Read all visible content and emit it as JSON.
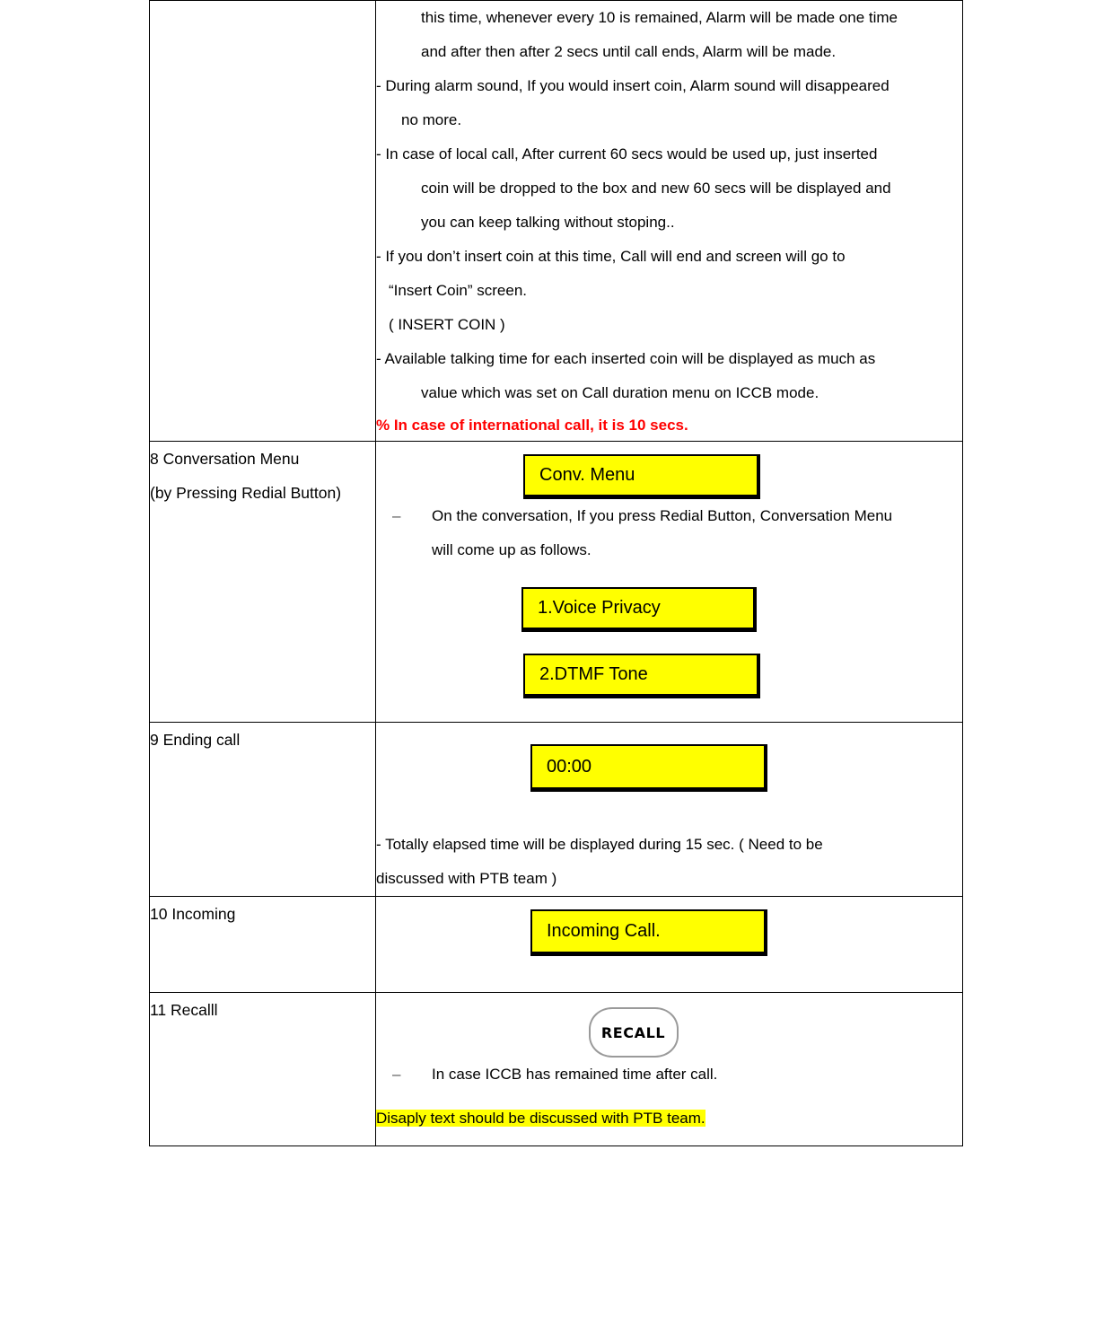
{
  "document": {
    "type": "specification-table",
    "table_columns": [
      "step",
      "description"
    ]
  },
  "rows": [
    {
      "id": "row-alarm-continuation",
      "label_lines": [],
      "paragraphs": [
        "this time, whenever every 10 is remained, Alarm will be made one time",
        "and after then after 2 secs until call ends, Alarm will be made.",
        "- During alarm sound, If you would insert coin, Alarm sound will disappeared",
        "no more.",
        "- In case of local call, After current 60 secs would be used up, just inserted",
        "coin will be dropped to the box and new 60 secs will be displayed and",
        "you can keep talking without stoping..",
        "- If you don’t insert coin at this time, Call will end and screen will go to",
        "“Insert Coin” screen.",
        "( INSERT COIN )",
        "- Available talking time for each inserted coin will be displayed as much as",
        "value which was set on Call duration menu on ICCB mode."
      ],
      "note_red": "% In case of international call, it is 10 secs."
    },
    {
      "id": "row-conversation-menu",
      "label_lines": [
        "8 Conversation Menu",
        "(by Pressing Redial Button)"
      ],
      "lcd_primary": "Conv. Menu",
      "bullet": {
        "mark": "–",
        "line1": "On the conversation, If you press Redial Button, Conversation Menu",
        "line2": "will come up as follows."
      },
      "lcd_options": [
        "1.Voice Privacy",
        "2.DTMF Tone"
      ]
    },
    {
      "id": "row-ending-call",
      "label_lines": [
        "9 Ending call"
      ],
      "lcd_primary": "00:00",
      "paragraphs": [
        "- Totally elapsed time will be displayed during 15 sec. ( Need to be",
        "discussed with PTB team )"
      ]
    },
    {
      "id": "row-incoming",
      "label_lines": [
        "10 Incoming"
      ],
      "lcd_primary": "Incoming Call."
    },
    {
      "id": "row-recall",
      "label_lines": [
        "11 Recalll"
      ],
      "key_label": "RECALL",
      "bullet": {
        "mark": "–",
        "line1": "In case ICCB has remained time after call."
      },
      "highlight_note": "Disaply text should be discussed with PTB team."
    }
  ],
  "colors": {
    "lcd_background": "#ffff00",
    "lcd_border": "#000000",
    "warning_text": "#ff0000",
    "highlight": "#ffff00",
    "key_border": "#9a9a9a",
    "table_border": "#000000"
  }
}
